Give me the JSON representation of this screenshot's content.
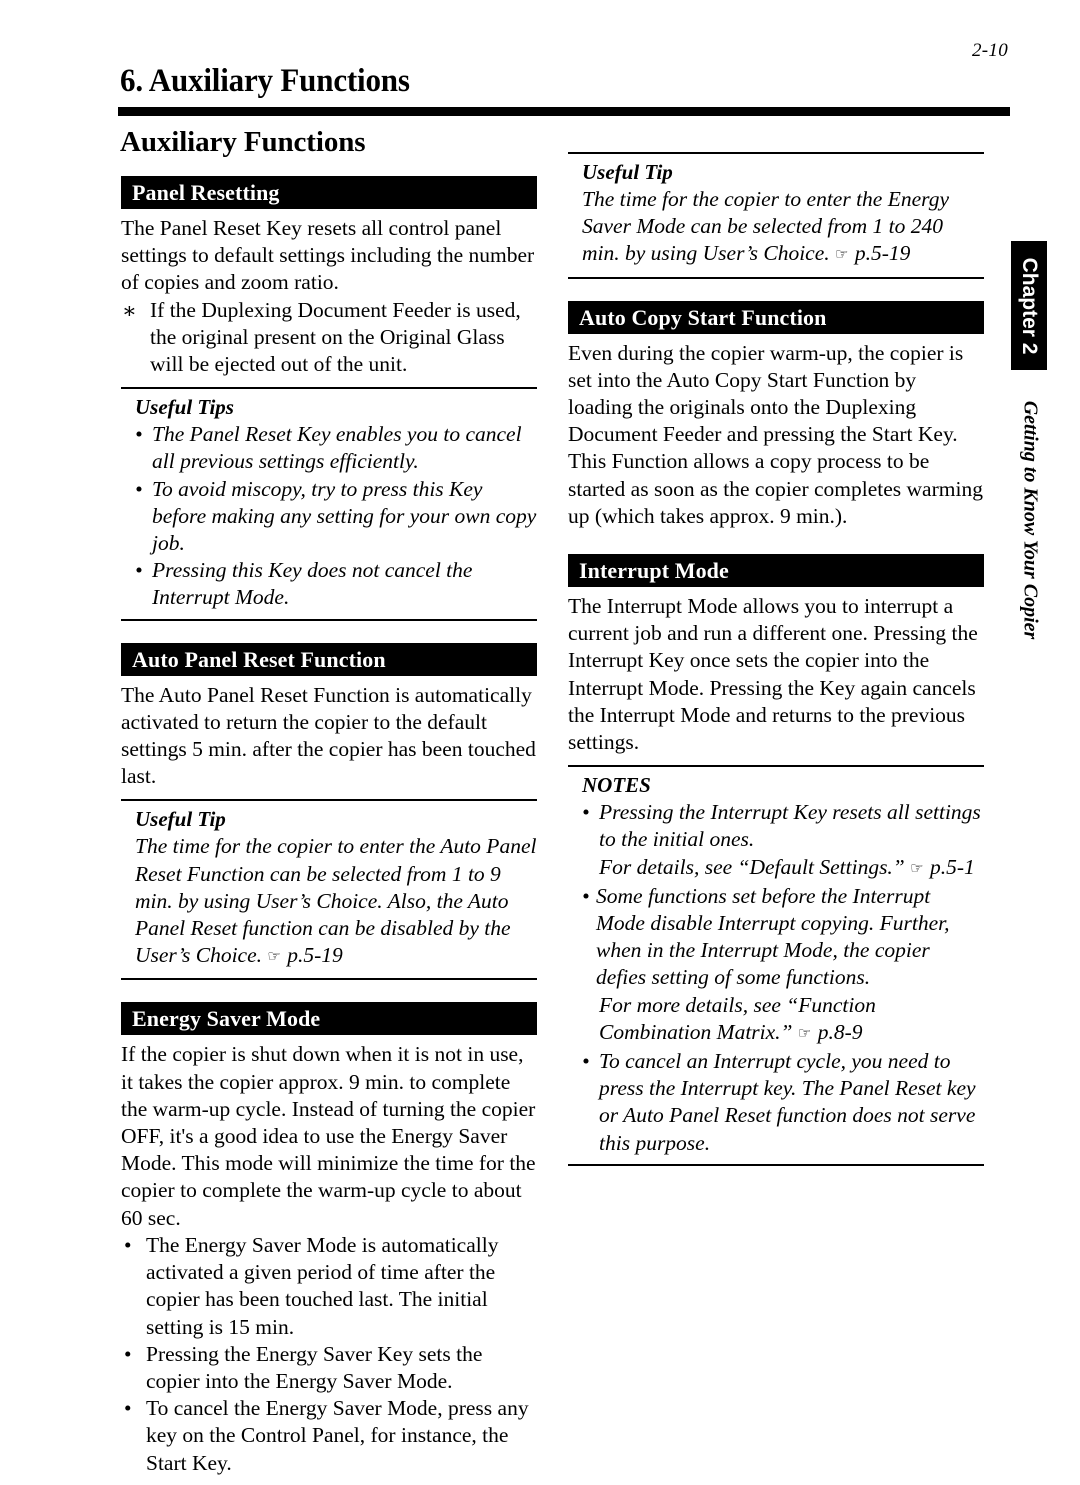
{
  "page": {
    "folio": "2-10",
    "chapter_head": "6. Auxiliary Functions",
    "section_title": "Auxiliary Functions"
  },
  "side_tab": {
    "chapter_box": "Chapter 2",
    "chapter_label": "Getting to Know Your Copier"
  },
  "left_column": {
    "panel_resetting": {
      "bar": "Panel Resetting",
      "paragraph": "The Panel Reset Key resets all control panel settings to default settings including the number of copies and zoom ratio.",
      "star_note": "If the Duplexing Document Feeder is used, the original present on the Original Glass will be ejected out of the unit.",
      "tips_title": "Useful Tips",
      "tips": [
        "The Panel Reset Key enables you to cancel all previous settings efficiently.",
        "To avoid miscopy, try to press this Key before making any setting for your own copy job.",
        "Pressing this Key does not cancel the Interrupt Mode."
      ]
    },
    "auto_panel_reset": {
      "bar": "Auto Panel Reset Function",
      "paragraph": "The Auto Panel Reset Function is automatically activated to return the copier to the default settings 5 min. after the copier has been touched last.",
      "tip_title": "Useful Tip",
      "tip_text": "The time for the copier to enter the Auto Panel Reset Function can be selected from 1 to 9 min. by using User’s Choice. Also, the Auto Panel Reset function can be disabled by the User’s Choice.",
      "tip_pointer": "☞",
      "tip_ref": "p.5-19"
    },
    "energy_saver": {
      "bar": "Energy Saver Mode",
      "paragraph": "If the copier is shut down when it is not in use, it takes the copier approx. 9 min. to complete the warm-up cycle. Instead of turning the copier OFF, it's a good idea to use the Energy Saver Mode. This mode will minimize the time for the copier to complete the warm-up cycle to about 60 sec.",
      "bullets": [
        "The Energy Saver Mode is automatically activated a given period of time after the copier has been touched last. The initial setting is 15 min.",
        "Pressing the Energy Saver Key sets the copier into the Energy Saver Mode.",
        "To cancel the Energy Saver Mode, press any key on the Control Panel, for instance, the Start Key."
      ]
    }
  },
  "right_column": {
    "energy_saver_tip": {
      "tip_title": "Useful Tip",
      "tip_text": "The time for the copier to enter the Energy Saver Mode can be selected from 1 to 240 min. by using User’s Choice.",
      "tip_pointer": "☞",
      "tip_ref": "p.5-19"
    },
    "auto_copy_start": {
      "bar": "Auto Copy Start Function",
      "paragraph_1": "Even during the copier warm-up, the copier is set into the Auto Copy Start Function by loading the originals onto the Duplexing Document Feeder and pressing the Start Key.",
      "paragraph_2": "This Function allows a copy process to be started as soon as the copier completes warming up (which takes approx. 9 min.)."
    },
    "interrupt_mode": {
      "bar": "Interrupt Mode",
      "paragraph": "The Interrupt Mode allows you to interrupt a current job and run a different one. Pressing the Interrupt Key once sets the copier into the Interrupt Mode. Pressing the Key again cancels the Interrupt Mode and returns to the previous settings.",
      "notes_title": "NOTES",
      "note_1": "Pressing the Interrupt Key resets all settings to the initial ones.",
      "note_1_cont": "For details, see “Default Settings.”",
      "note_1_pointer": "☞",
      "note_1_ref": "p.5-1",
      "note_2": "Some functions set before the Interrupt Mode disable Interrupt copying.  Further, when in the Interrupt Mode, the copier defies setting of some functions.",
      "note_2_cont": "For more details, see “Function Combination Matrix.”",
      "note_2_pointer": "☞",
      "note_2_ref": "p.8-9",
      "note_3": "To cancel an Interrupt cycle, you need to press the Interrupt key. The Panel Reset key or Auto Panel Reset function does not serve this purpose."
    }
  }
}
